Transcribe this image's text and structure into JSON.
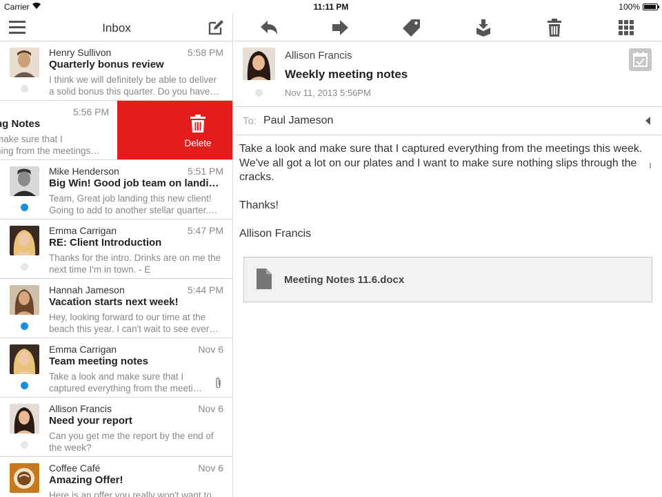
{
  "status_bar": {
    "carrier": "Carrier",
    "time": "11:11 PM",
    "battery": "100%"
  },
  "inbox": {
    "title": "Inbox",
    "swiped_item": {
      "time": "5:56 PM",
      "subject_fragment": "ng Notes",
      "preview_line1": " make sure that I",
      "preview_line2": "ning from the meetings…",
      "delete_label": "Delete"
    },
    "items": [
      {
        "sender": "Henry Sullivon",
        "time": "5:58 PM",
        "subject": "Quarterly bonus review",
        "preview1": "I think we will definitely be able to deliver",
        "preview2": "a solid bonus this quarter. Do you have…",
        "unread": false,
        "attachment": false,
        "avatar_color": "#c9a27a"
      },
      {
        "sender": "Mike Henderson",
        "time": "5:51 PM",
        "subject": "Big Win! Good job team on landin…",
        "preview1": "Team, Great job landing this new client!",
        "preview2": "Going to add to another stellar quarter.…",
        "unread": true,
        "attachment": false,
        "avatar_color": "#6f6f6f"
      },
      {
        "sender": "Emma Carrigan",
        "time": "5:47 PM",
        "subject": "RE: Client Introduction",
        "preview1": "Thanks for the intro. Drinks are on me the",
        "preview2": "next time I'm in town. - E",
        "unread": false,
        "attachment": false,
        "avatar_color": "#d9b46a"
      },
      {
        "sender": "Hannah Jameson",
        "time": "5:44 PM",
        "subject": "Vacation starts next week!",
        "preview1": "Hey, looking forward to our time at the",
        "preview2": "beach this year. I can't wait to see ever…",
        "unread": true,
        "attachment": false,
        "avatar_color": "#b98a5e"
      },
      {
        "sender": "Emma Carrigan",
        "time": "Nov 6",
        "subject": "Team meeting notes",
        "preview1": "Take a look and make sure that I",
        "preview2": "captured everything from the meeti…",
        "unread": true,
        "attachment": true,
        "avatar_color": "#d9b46a"
      },
      {
        "sender": "Allison Francis",
        "time": "Nov 6",
        "subject": "Need your report",
        "preview1": "Can you get me the report by the end of",
        "preview2": "the week?",
        "unread": false,
        "attachment": false,
        "avatar_color": "#4a3630"
      },
      {
        "sender": "Coffee Café",
        "time": "Nov 6",
        "subject": "Amazing Offer!",
        "preview1": "Here is an offer you really won't want to",
        "preview2": "",
        "unread": false,
        "attachment": false,
        "avatar_color": "#b5651d"
      }
    ]
  },
  "message": {
    "from": "Allison Francis",
    "subject": "Weekly meeting notes",
    "date": "Nov 11, 2013 5:56PM",
    "to_label": "To:",
    "to": "Paul Jameson",
    "body": [
      "Take a look and make sure that I captured everything from the meetings this week. We've all got a lot on our plates and I want to make sure nothing slips through the cracks.",
      "Thanks!",
      "Allison Francis"
    ],
    "attachment_name": "Meeting Notes 11.6.docx"
  },
  "toolbar_icons": [
    "reply-icon",
    "forward-icon",
    "tag-icon",
    "archive-icon",
    "trash-icon",
    "grid-icon"
  ],
  "colors": {
    "delete_red": "#e31c1c",
    "unread_blue": "#1b8fdb"
  }
}
